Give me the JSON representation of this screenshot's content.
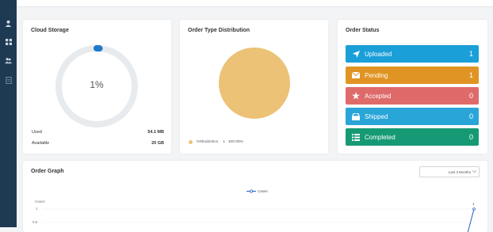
{
  "sidebar": {
    "items": [
      {
        "icon": "user-icon"
      },
      {
        "icon": "grid-icon"
      },
      {
        "icon": "users-icon"
      },
      {
        "icon": "document-icon"
      }
    ]
  },
  "cloud_storage": {
    "title": "Cloud Storage",
    "percent_label": "1%",
    "percent_value": 1,
    "used_label": "Used",
    "used_value": "54.1 MB",
    "available_label": "Available",
    "available_value": "20 GB"
  },
  "order_type": {
    "title": "Order Type Distribution",
    "legend_name": "Orthodontics",
    "legend_count": "1",
    "legend_percent": "100.00%",
    "color": "#ecc276"
  },
  "order_status": {
    "title": "Order Status",
    "items": [
      {
        "label": "Uploaded",
        "count": "1",
        "color": "#1a9fd9",
        "icon": "send-icon"
      },
      {
        "label": "Pending",
        "count": "1",
        "color": "#e09423",
        "icon": "mail-icon"
      },
      {
        "label": "Accepted",
        "count": "0",
        "color": "#df6a6a",
        "icon": "star-icon"
      },
      {
        "label": "Shipped",
        "count": "0",
        "color": "#2aa5d8",
        "icon": "box-icon"
      },
      {
        "label": "Completed",
        "count": "0",
        "color": "#169a75",
        "icon": "list-icon"
      }
    ]
  },
  "order_graph": {
    "title": "Order Graph",
    "range_select": "Last 3 Months",
    "legend": "Cases",
    "y_axis_title": "Cases",
    "y_ticks": [
      "1",
      "0.8"
    ],
    "last_point_label": "1"
  },
  "chart_data": {
    "type": "line",
    "title": "Order Graph",
    "ylabel": "Cases",
    "series": [
      {
        "name": "Cases",
        "values": [
          0,
          1
        ]
      }
    ],
    "y_ticks": [
      1,
      0.8
    ],
    "point_labels": [
      "1"
    ]
  }
}
